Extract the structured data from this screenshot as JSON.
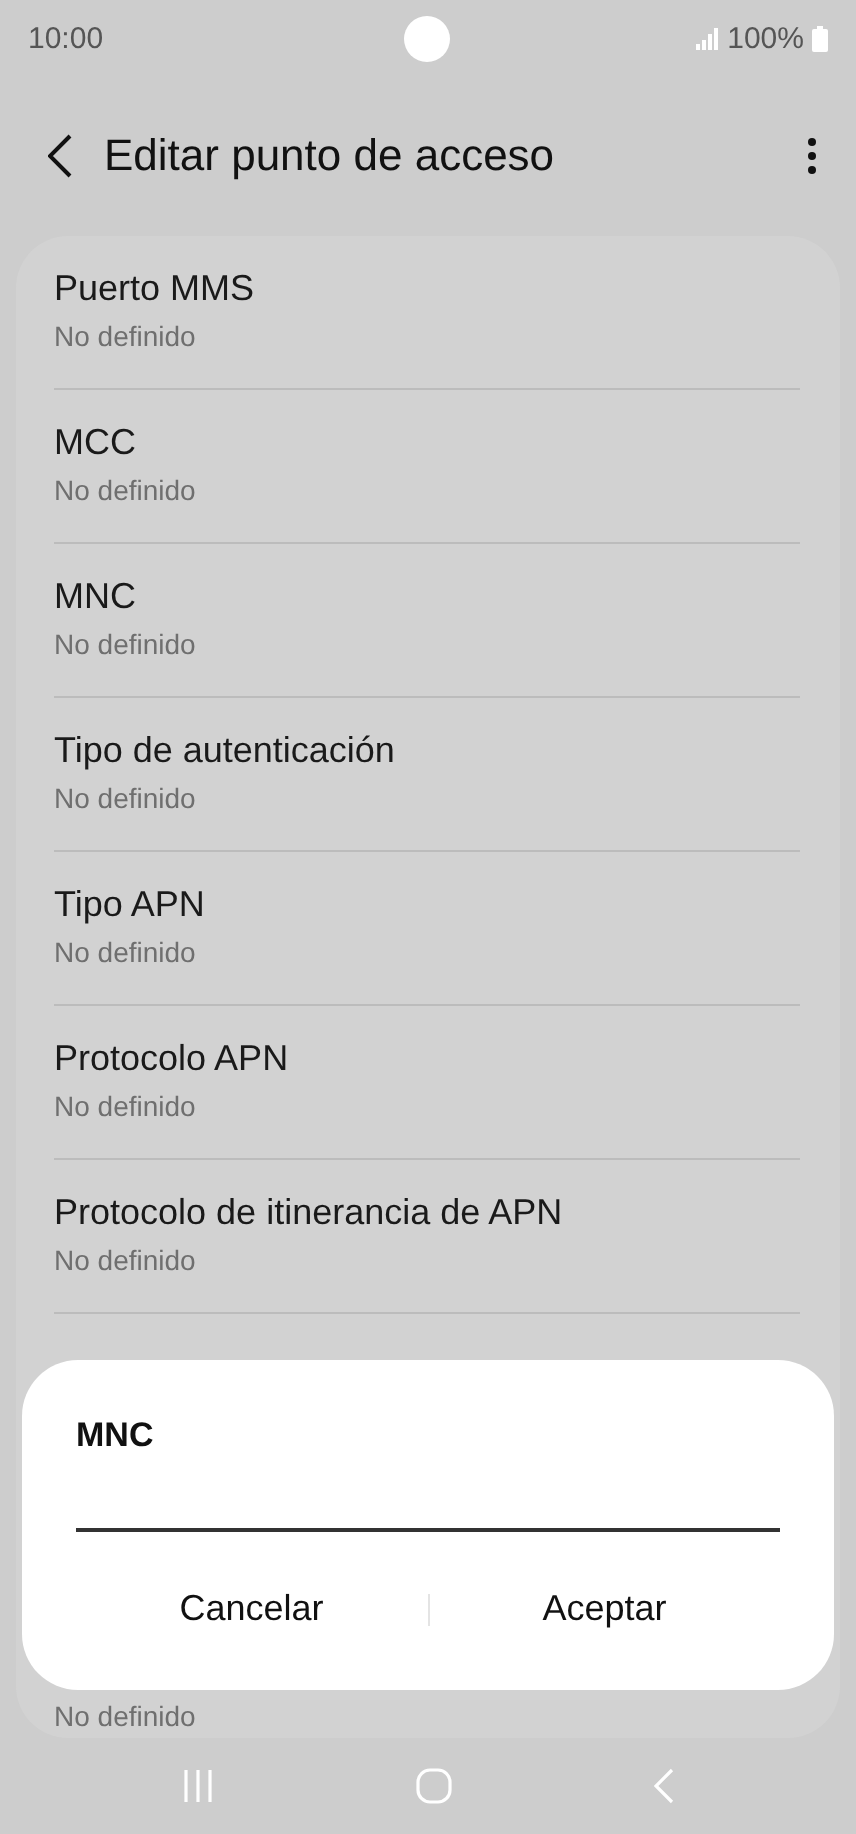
{
  "status_bar": {
    "time": "10:00",
    "battery": "100%"
  },
  "header": {
    "title": "Editar punto de acceso"
  },
  "settings": [
    {
      "title": "Puerto MMS",
      "subtitle": "No definido"
    },
    {
      "title": "MCC",
      "subtitle": "No definido"
    },
    {
      "title": "MNC",
      "subtitle": "No definido"
    },
    {
      "title": "Tipo de autenticación",
      "subtitle": "No definido"
    },
    {
      "title": "Tipo APN",
      "subtitle": "No definido"
    },
    {
      "title": "Protocolo APN",
      "subtitle": "No definido"
    },
    {
      "title": "Protocolo de itinerancia de APN",
      "subtitle": "No definido"
    },
    {
      "kind": "covered"
    },
    {
      "subtitle": "No definido"
    }
  ],
  "dialog": {
    "title": "MNC",
    "buttons": [
      "Cancelar",
      "Aceptar"
    ]
  }
}
